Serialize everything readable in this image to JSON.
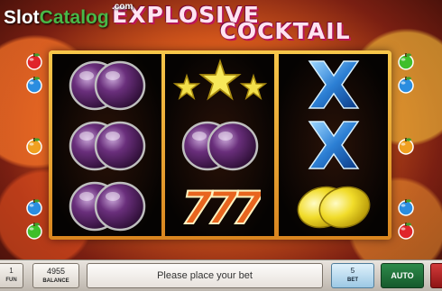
{
  "game": {
    "title_line1": "EXPLOSIVE",
    "title_line2": "COCKTAIL",
    "watermark": {
      "part1": "Slot",
      "part2": "Catalog",
      "suffix": ".com"
    }
  },
  "reels": [
    [
      "plum",
      "plum",
      "plum"
    ],
    [
      "star",
      "plum",
      "seven"
    ],
    [
      "cross",
      "cross",
      "lemon"
    ]
  ],
  "side_markers": {
    "left": [
      "red-apple-icon",
      "blue-apple-icon",
      "orange-apple-icon",
      "blue-apple-icon",
      "green-apple-icon"
    ],
    "right": [
      "green-apple-icon",
      "blue-apple-icon",
      "orange-apple-icon",
      "blue-apple-icon",
      "red-apple-icon"
    ]
  },
  "bottom_bar": {
    "fun_value": "1",
    "fun_label": "FUN",
    "balance_value": "4955",
    "balance_label": "BALANCE",
    "message": "Please place your bet",
    "bet_value": "5",
    "bet_label": "BET",
    "auto_label": "AUTO"
  },
  "colors": {
    "reel_frame": "#f0b23a",
    "auto_button": "#2d8a4a",
    "bet_button": "#9cc8e4",
    "spin_button": "#c02828",
    "title_pink": "#c4185a"
  }
}
